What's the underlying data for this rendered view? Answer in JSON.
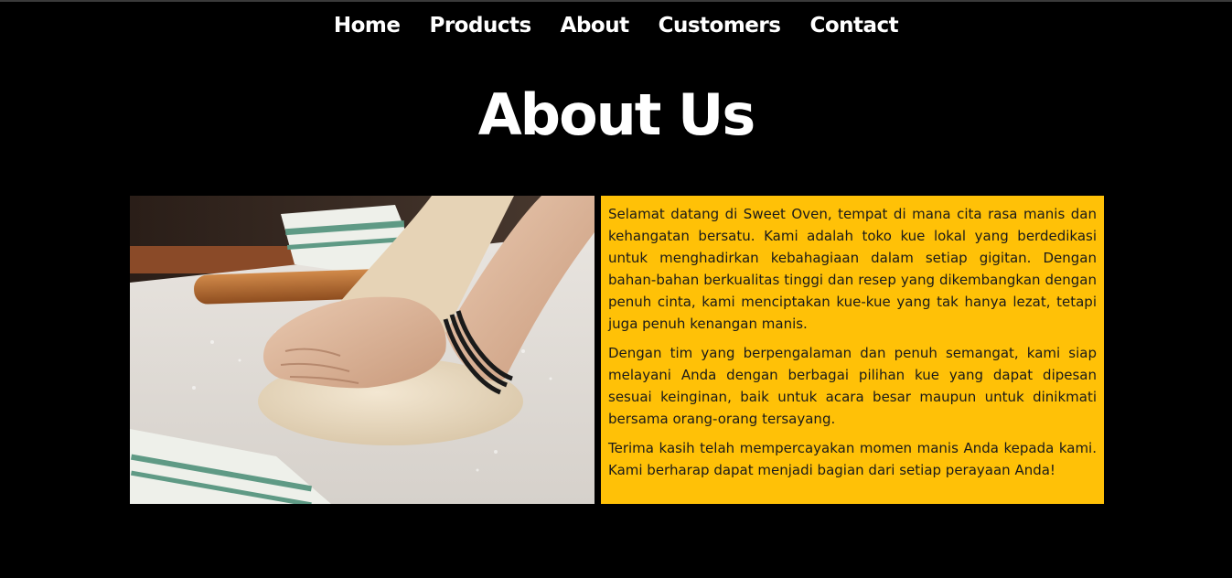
{
  "nav": {
    "items": [
      {
        "label": "Home"
      },
      {
        "label": "Products"
      },
      {
        "label": "About"
      },
      {
        "label": "Customers"
      },
      {
        "label": "Contact"
      }
    ]
  },
  "page": {
    "title": "About Us"
  },
  "about": {
    "paragraphs": [
      "Selamat datang di Sweet Oven, tempat di mana cita rasa manis dan kehangatan bersatu. Kami adalah toko kue lokal yang berdedikasi untuk menghadirkan kebahagiaan dalam setiap gigitan. Dengan bahan-bahan berkualitas tinggi dan resep yang dikembangkan dengan penuh cinta, kami menciptakan kue-kue yang tak hanya lezat, tetapi juga penuh kenangan manis.",
      "Dengan tim yang berpengalaman dan penuh semangat, kami siap melayani Anda dengan berbagai pilihan kue yang dapat dipesan sesuai keinginan, baik untuk acara besar maupun untuk dinikmati bersama orang-orang tersayang.",
      "Terima kasih telah mempercayakan momen manis Anda kepada kami. Kami berharap dapat menjadi bagian dari setiap perayaan Anda!"
    ]
  },
  "colors": {
    "background": "#000000",
    "accent": "#ffc107",
    "text_light": "#ffffff",
    "text_dark": "#1a1a1a"
  },
  "image": {
    "subject": "hands-kneading-dough-photo"
  }
}
